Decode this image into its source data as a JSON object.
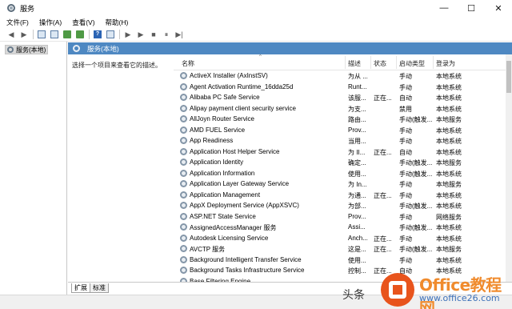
{
  "window": {
    "title": "服务",
    "minimize": "—",
    "maximize": "☐",
    "close": "✕"
  },
  "menu": [
    "文件(F)",
    "操作(A)",
    "查看(V)",
    "帮助(H)"
  ],
  "toolbar": {
    "back": "◀",
    "forward": "▶",
    "play": "▶",
    "play2": "▶",
    "stop": "■",
    "pause": "⏸",
    "resume": "▶|"
  },
  "tree": {
    "root_label": "服务(本地)"
  },
  "panel": {
    "header_label": "服务(本地)"
  },
  "description": {
    "hint": "选择一个项目来查看它的描述。"
  },
  "columns": {
    "name": "名称",
    "desc": "描述",
    "status": "状态",
    "startup": "启动类型",
    "logon": "登录为"
  },
  "services": [
    {
      "name": "ActiveX Installer (AxInstSV)",
      "desc": "为从 ...",
      "status": "",
      "startup": "手动",
      "logon": "本地系统"
    },
    {
      "name": "Agent Activation Runtime_16dda25d",
      "desc": "Runt...",
      "status": "",
      "startup": "手动",
      "logon": "本地系统"
    },
    {
      "name": "Alibaba PC Safe Service",
      "desc": "该服...",
      "status": "正在...",
      "startup": "自动",
      "logon": "本地系统"
    },
    {
      "name": "Alipay payment client security service",
      "desc": "为支...",
      "status": "",
      "startup": "禁用",
      "logon": "本地系统"
    },
    {
      "name": "AllJoyn Router Service",
      "desc": "路由...",
      "status": "",
      "startup": "手动(触发...",
      "logon": "本地服务"
    },
    {
      "name": "AMD FUEL Service",
      "desc": "Prov...",
      "status": "",
      "startup": "手动",
      "logon": "本地系统"
    },
    {
      "name": "App Readiness",
      "desc": "当用...",
      "status": "",
      "startup": "手动",
      "logon": "本地系统"
    },
    {
      "name": "Application Host Helper Service",
      "desc": "为 II...",
      "status": "正在...",
      "startup": "自动",
      "logon": "本地系统"
    },
    {
      "name": "Application Identity",
      "desc": "确定...",
      "status": "",
      "startup": "手动(触发...",
      "logon": "本地服务"
    },
    {
      "name": "Application Information",
      "desc": "使用...",
      "status": "",
      "startup": "手动(触发...",
      "logon": "本地系统"
    },
    {
      "name": "Application Layer Gateway Service",
      "desc": "为 In...",
      "status": "",
      "startup": "手动",
      "logon": "本地服务"
    },
    {
      "name": "Application Management",
      "desc": "为通...",
      "status": "正在...",
      "startup": "手动",
      "logon": "本地系统"
    },
    {
      "name": "AppX Deployment Service (AppXSVC)",
      "desc": "为部...",
      "status": "",
      "startup": "手动(触发...",
      "logon": "本地系统"
    },
    {
      "name": "ASP.NET State Service",
      "desc": "Prov...",
      "status": "",
      "startup": "手动",
      "logon": "网络服务"
    },
    {
      "name": "AssignedAccessManager 服务",
      "desc": "Assi...",
      "status": "",
      "startup": "手动(触发...",
      "logon": "本地系统"
    },
    {
      "name": "Autodesk Licensing Service",
      "desc": "Anch...",
      "status": "正在...",
      "startup": "手动",
      "logon": "本地系统"
    },
    {
      "name": "AVCTP 服务",
      "desc": "这是...",
      "status": "正在...",
      "startup": "手动(触发...",
      "logon": "本地服务"
    },
    {
      "name": "Background Intelligent Transfer Service",
      "desc": "使用...",
      "status": "",
      "startup": "手动",
      "logon": "本地系统"
    },
    {
      "name": "Background Tasks Infrastructure Service",
      "desc": "控制...",
      "status": "正在...",
      "startup": "自动",
      "logon": "本地系统"
    },
    {
      "name": "Base Filtering Engine",
      "desc": "",
      "status": "",
      "startup": "",
      "logon": ""
    }
  ],
  "tabs": {
    "extended": "扩展",
    "standard": "标准"
  },
  "watermark": {
    "toutiao": "头条",
    "brand": "Office教程网",
    "url": "www.office26.com"
  },
  "colors": {
    "panel_header": "#4e88c2",
    "brand_orange": "#e8541c"
  }
}
